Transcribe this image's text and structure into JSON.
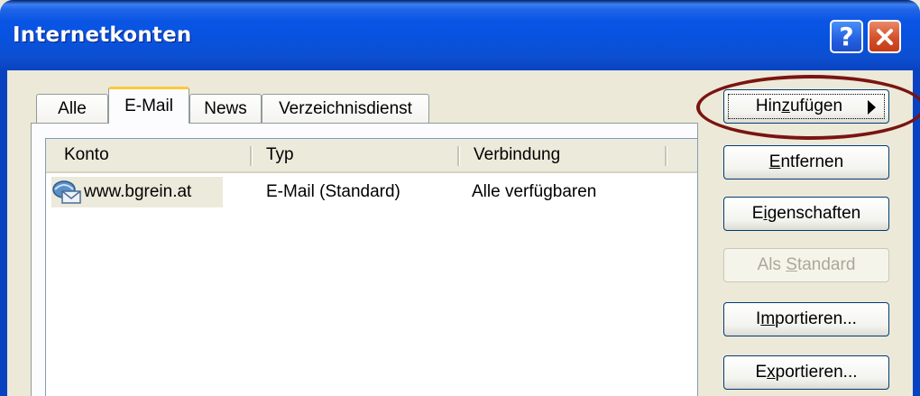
{
  "window": {
    "title": "Internetkonten",
    "help_label": "?",
    "close_label": "✕"
  },
  "tabs": [
    {
      "label": "Alle",
      "active": false
    },
    {
      "label": "E-Mail",
      "active": true
    },
    {
      "label": "News",
      "active": false
    },
    {
      "label": "Verzeichnisdienst",
      "active": false
    }
  ],
  "accounts": {
    "columns": [
      "Konto",
      "Typ",
      "Verbindung"
    ],
    "rows": [
      {
        "konto": "www.bgrein.at",
        "typ": "E-Mail (Standard)",
        "verbindung": "Alle verfügbaren",
        "icon": "mail-account-icon"
      }
    ]
  },
  "buttons": {
    "add": {
      "before": "Hin",
      "mnemonic": "z",
      "after": "ufügen"
    },
    "remove": {
      "before": "",
      "mnemonic": "E",
      "after": "ntfernen"
    },
    "properties": {
      "before": "E",
      "mnemonic": "i",
      "after": "genschaften"
    },
    "set_default": {
      "before": "Als ",
      "mnemonic": "S",
      "after": "tandard",
      "enabled": false
    },
    "import": {
      "before": "I",
      "mnemonic": "m",
      "after": "portieren..."
    },
    "export": {
      "before": "E",
      "mnemonic": "x",
      "after": "portieren..."
    }
  },
  "annotation_color": "#7a1410"
}
